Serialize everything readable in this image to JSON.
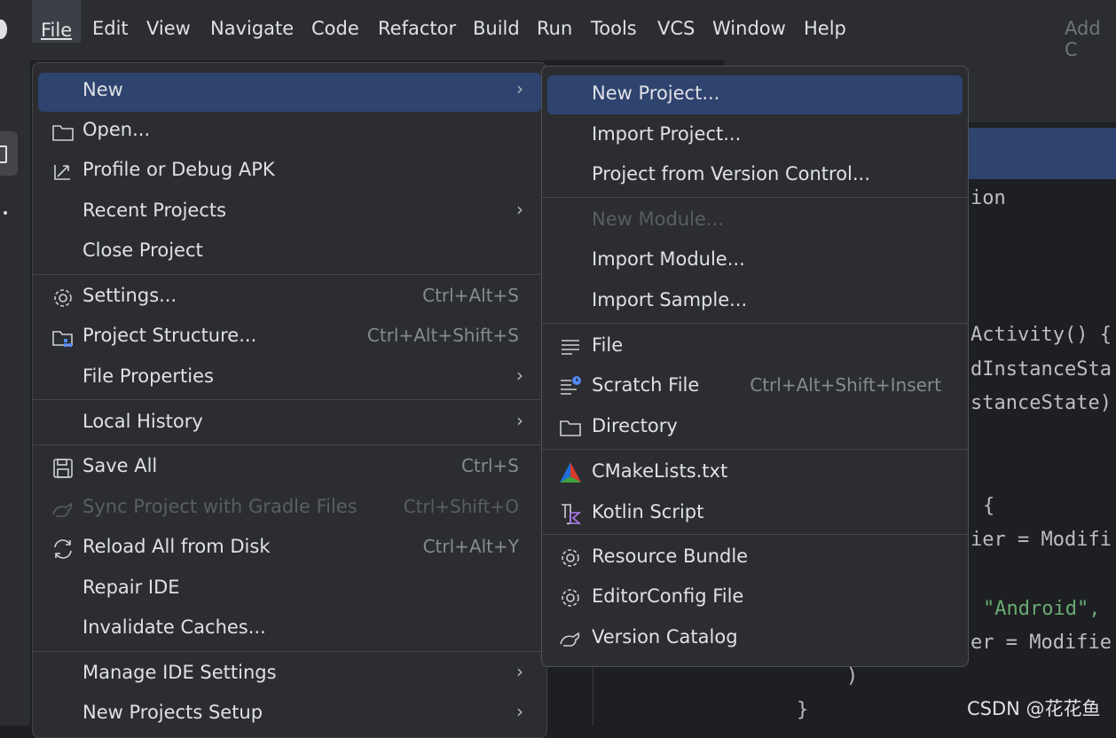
{
  "menubar": {
    "items": [
      "File",
      "Edit",
      "View",
      "Navigate",
      "Code",
      "Refactor",
      "Build",
      "Run",
      "Tools",
      "VCS",
      "Window",
      "Help"
    ],
    "right_text": "Add C"
  },
  "file_menu": {
    "items": [
      {
        "label": "New",
        "icon": "none",
        "shortcut": "",
        "submenu": true
      },
      {
        "label": "Open...",
        "icon": "folder-icon",
        "shortcut": "",
        "submenu": false
      },
      {
        "label": "Profile or Debug APK",
        "icon": "profile-debug-icon",
        "shortcut": "",
        "submenu": false
      },
      {
        "label": "Recent Projects",
        "icon": "none",
        "shortcut": "",
        "submenu": true
      },
      {
        "label": "Close Project",
        "icon": "none",
        "shortcut": "",
        "submenu": false
      },
      {
        "label": "Settings...",
        "icon": "gear-icon",
        "shortcut": "Ctrl+Alt+S",
        "submenu": false
      },
      {
        "label": "Project Structure...",
        "icon": "project-structure-icon",
        "shortcut": "Ctrl+Alt+Shift+S",
        "submenu": false
      },
      {
        "label": "File Properties",
        "icon": "none",
        "shortcut": "",
        "submenu": true
      },
      {
        "label": "Local History",
        "icon": "none",
        "shortcut": "",
        "submenu": true
      },
      {
        "label": "Save All",
        "icon": "save-icon",
        "shortcut": "Ctrl+S",
        "submenu": false
      },
      {
        "label": "Sync Project with Gradle Files",
        "icon": "gradle-sync-icon",
        "shortcut": "Ctrl+Shift+O",
        "submenu": false,
        "disabled": true
      },
      {
        "label": "Reload All from Disk",
        "icon": "reload-icon",
        "shortcut": "Ctrl+Alt+Y",
        "submenu": false
      },
      {
        "label": "Repair IDE",
        "icon": "none",
        "shortcut": "",
        "submenu": false
      },
      {
        "label": "Invalidate Caches...",
        "icon": "none",
        "shortcut": "",
        "submenu": false
      },
      {
        "label": "Manage IDE Settings",
        "icon": "none",
        "shortcut": "",
        "submenu": true
      },
      {
        "label": "New Projects Setup",
        "icon": "none",
        "shortcut": "",
        "submenu": true
      }
    ]
  },
  "new_submenu": {
    "items": [
      {
        "label": "New Project...",
        "icon": "none",
        "shortcut": ""
      },
      {
        "label": "Import Project...",
        "icon": "none",
        "shortcut": ""
      },
      {
        "label": "Project from Version Control...",
        "icon": "none",
        "shortcut": ""
      },
      {
        "label": "New Module...",
        "icon": "none",
        "shortcut": "",
        "disabled": true
      },
      {
        "label": "Import Module...",
        "icon": "none",
        "shortcut": ""
      },
      {
        "label": "Import Sample...",
        "icon": "none",
        "shortcut": ""
      },
      {
        "label": "File",
        "icon": "text-file-icon",
        "shortcut": ""
      },
      {
        "label": "Scratch File",
        "icon": "scratch-file-icon",
        "shortcut": "Ctrl+Alt+Shift+Insert"
      },
      {
        "label": "Directory",
        "icon": "folder-icon",
        "shortcut": ""
      },
      {
        "label": "CMakeLists.txt",
        "icon": "cmake-icon",
        "shortcut": ""
      },
      {
        "label": "Kotlin Script",
        "icon": "kotlin-script-icon",
        "shortcut": ""
      },
      {
        "label": "Resource Bundle",
        "icon": "gear-icon",
        "shortcut": ""
      },
      {
        "label": "EditorConfig File",
        "icon": "gear-icon",
        "shortcut": ""
      },
      {
        "label": "Version Catalog",
        "icon": "version-catalog-icon",
        "shortcut": ""
      }
    ]
  },
  "editor": {
    "lines": [
      "ion",
      "Activity() {",
      "dInstanceSta",
      "stanceState)",
      "{",
      "ier = Modifi",
      "\"Android\",",
      "er = Modifie",
      ")",
      "}"
    ]
  },
  "watermark": "CSDN @花花鱼",
  "colors": {
    "selection": "#2e436e",
    "menu_bg": "#2b2d30",
    "string": "#6aab73"
  }
}
